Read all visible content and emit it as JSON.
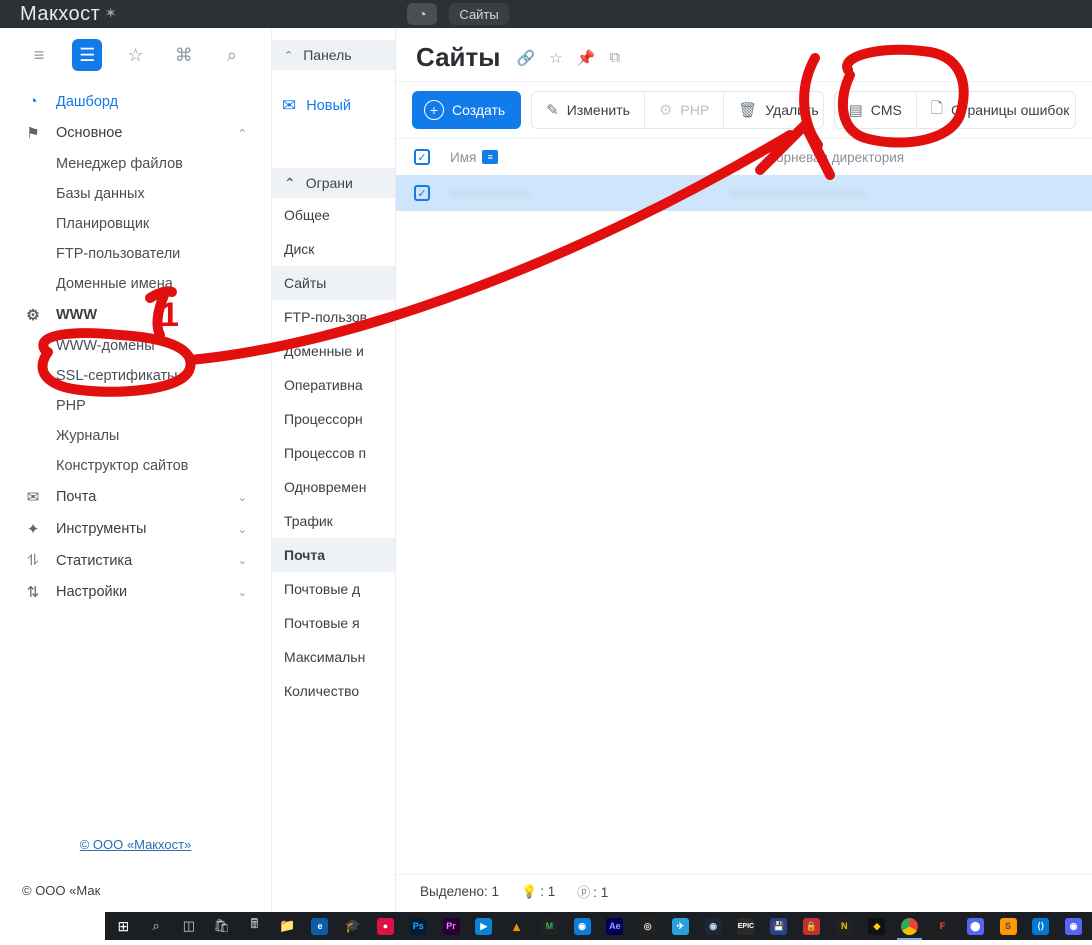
{
  "brand": {
    "name": "Макхост"
  },
  "topbar": {
    "tab": "Сайты"
  },
  "nav": {
    "dashboard": "Дашборд",
    "main_section": "Основное",
    "items_main": [
      "Менеджер файлов",
      "Базы данных",
      "Планировщик",
      "FTP-пользователи",
      "Доменные имена"
    ],
    "www_section": "WWW",
    "items_www": [
      "WWW-домены",
      "SSL-сертификаты",
      "PHP",
      "Журналы",
      "Конструктор сайтов"
    ],
    "mail": "Почта",
    "tools": "Инструменты",
    "stats": "Статистика",
    "settings": "Настройки",
    "copyright_link": "© ООО «Макхост»",
    "copyright_cut": "© ООО «Мак"
  },
  "sec": {
    "panel": "Панель",
    "new": "Новый",
    "limits": "Ограни",
    "items": [
      "Общее",
      "Диск",
      "Сайты",
      "FTP-пользов",
      "Доменные и",
      "Оперативна",
      "Процессорн",
      "Процессов п",
      "Одновремен",
      "Трафик",
      "Почта",
      "Почтовые д",
      "Почтовые я",
      "Максимальн",
      "Количество"
    ],
    "selected_idx": [
      2,
      10
    ],
    "bold_idx": [
      10
    ]
  },
  "main": {
    "title": "Сайты",
    "buttons": {
      "create": "Создать",
      "edit": "Изменить",
      "php": "PHP",
      "delete": "Удалить",
      "cms": "CMS",
      "error_pages": "Страницы ошибок"
    },
    "table": {
      "col_name": "Имя",
      "col_dir": "Корневая директория",
      "row_name": "───────",
      "row_dir": "────────────"
    },
    "status": {
      "selected_label": "Выделено:",
      "selected_count": "1",
      "bulb_count": ": 1",
      "php_count": ": 1"
    }
  },
  "annotation": {
    "label1": "1"
  },
  "taskbar_icons": [
    "win",
    "search",
    "tasks",
    "store",
    "calc",
    "folder",
    "edge",
    "hat",
    "mark",
    "ps",
    "pr",
    "py",
    "vlc",
    "m",
    "mega",
    "st",
    "ghost",
    "tg",
    "steam",
    "epic",
    "disk",
    "lock",
    "n",
    "yd",
    "chrome",
    "figma",
    "tg2",
    "subl",
    "vscode",
    "dcd"
  ]
}
